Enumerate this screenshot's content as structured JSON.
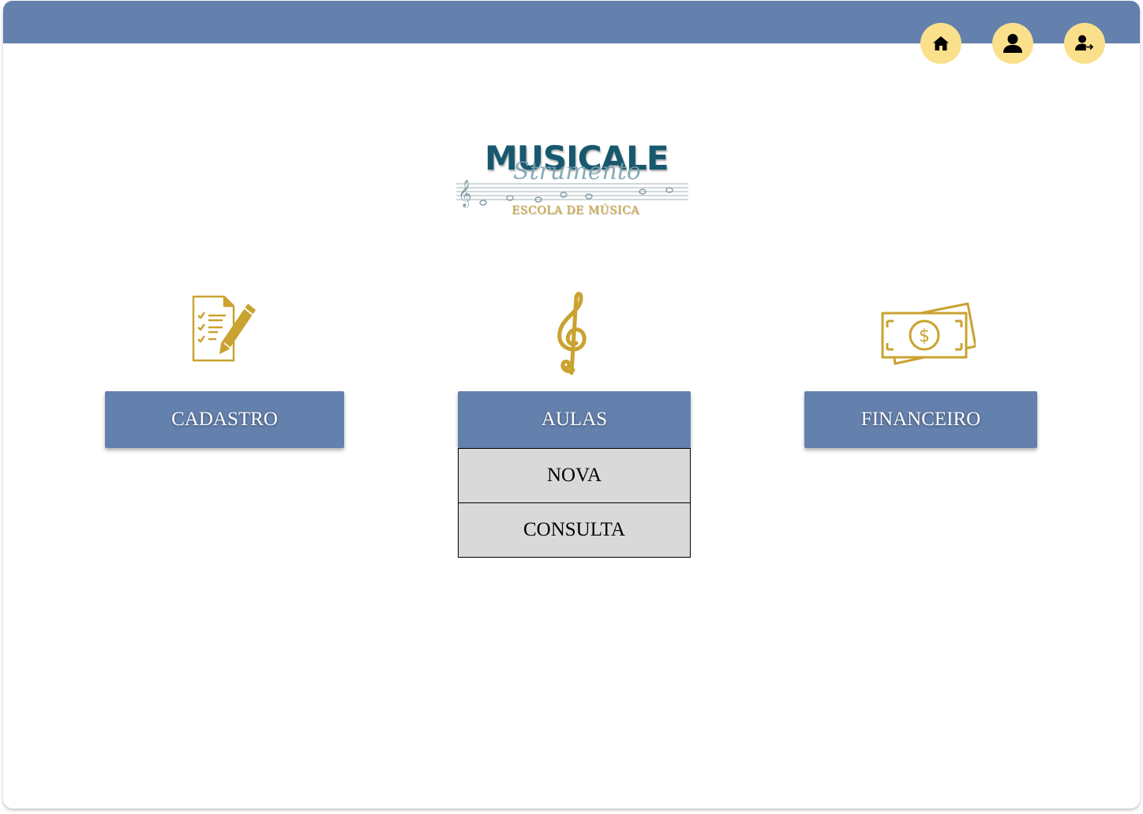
{
  "logo": {
    "title": "MUSICALE",
    "script": "Strumento",
    "subtitle": "ESCOLA DE MÚSICA"
  },
  "nav": {
    "home_icon": "home-icon",
    "profile_icon": "user-icon",
    "logout_icon": "user-exit-icon"
  },
  "menu": {
    "cadastro": {
      "label": "CADASTRO",
      "icon": "checklist-pencil-icon"
    },
    "aulas": {
      "label": "AULAS",
      "icon": "treble-clef-icon"
    },
    "financeiro": {
      "label": "FINANCEIRO",
      "icon": "money-bills-icon"
    }
  },
  "submenu": {
    "items": [
      {
        "label": "NOVA"
      },
      {
        "label": "CONSULTA"
      }
    ]
  },
  "colors": {
    "primary": "#6480ad",
    "accent": "#fbe08c",
    "gold": "#c9a22f",
    "logo_teal": "#17586e",
    "submenu_bg": "#d9d9d9"
  }
}
